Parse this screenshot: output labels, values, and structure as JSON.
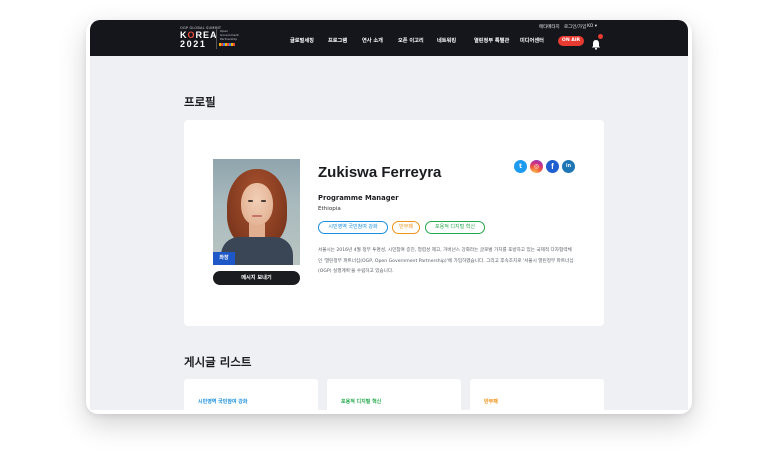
{
  "header": {
    "logo": {
      "small_text": "OGP GLOBAL SUMMIT",
      "line1": "KOREA",
      "line2": "2021",
      "partner_text": [
        "Open",
        "Government",
        "Partnership"
      ]
    },
    "utility": {
      "link1": "메타메타지",
      "link2": "로그인/가입",
      "lang": "KO"
    },
    "nav": [
      "글로벌세칭",
      "프로그램",
      "연사 소개",
      "오픈 이고리",
      "네트워킹",
      "열린정부 특별관",
      "미디어센터"
    ],
    "on_air": "ON AIR",
    "bell_badge": ""
  },
  "profile": {
    "heading": "프로필",
    "name": "Zukiswa Ferreyra",
    "title": "Programme Manager",
    "country": "Ethiopia",
    "role_badge": "좌장",
    "message_button": "메시지 보내기",
    "tags": [
      {
        "label": "시민영역 국민참여 강화",
        "color": "#1a8fe0"
      },
      {
        "label": "반부패",
        "color": "#f0931a"
      },
      {
        "label": "포용적 디지털 혁신",
        "color": "#23a84a"
      }
    ],
    "bio": "서울시는 2016년 4월 정부 투명성, 시민참여 증진, 청렴성 제고, 거버넌스 강화라는 글로벌 가치를 포방하고 있는 국제적 다자협력체인 '열린정부 파트너십(OGP, Open Government Partnership)'에 가입하였습니다. 그리고 후속조치로 '서울시 열린정부 파트너십(OGP) 실행계획'을 수립하고 있습니다.",
    "social": {
      "twitter": "twitter-icon",
      "instagram": "instagram-icon",
      "facebook": "facebook-icon",
      "linkedin": "linkedin-icon"
    }
  },
  "posts": {
    "heading": "게시글 리스트",
    "items": [
      {
        "category": "시민영역 국민참여 강화",
        "color": "#1a8fe0"
      },
      {
        "category": "포용적 디지털 혁신",
        "color": "#23a84a"
      },
      {
        "category": "반부패",
        "color": "#f0931a"
      }
    ]
  }
}
